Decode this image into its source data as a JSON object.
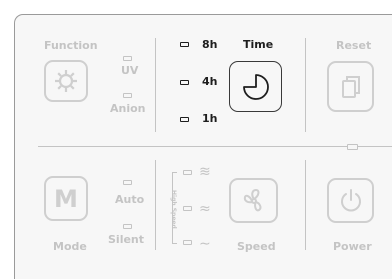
{
  "function": {
    "label": "Function",
    "uv": "UV",
    "anion": "Anion"
  },
  "timer": {
    "h8": "8h",
    "h4": "4h",
    "h1": "1h",
    "label": "Time"
  },
  "reset": {
    "label": "Reset"
  },
  "mode": {
    "button": "M",
    "label": "Mode",
    "auto": "Auto",
    "silent": "Silent"
  },
  "speed": {
    "label": "Speed",
    "side_label": "High Speed"
  },
  "power": {
    "label": "Power"
  },
  "colors": {
    "active": "#1e1e1e",
    "inactive": "#c4c4c4",
    "panel": "#f7f7f7"
  },
  "icons": {
    "function": "gear-icon",
    "time": "clock-icon",
    "reset": "copy-icon",
    "speed": "fan-icon",
    "power": "power-icon",
    "speed_levels": [
      "wave-high-icon",
      "wave-medium-icon",
      "wave-low-icon"
    ]
  }
}
